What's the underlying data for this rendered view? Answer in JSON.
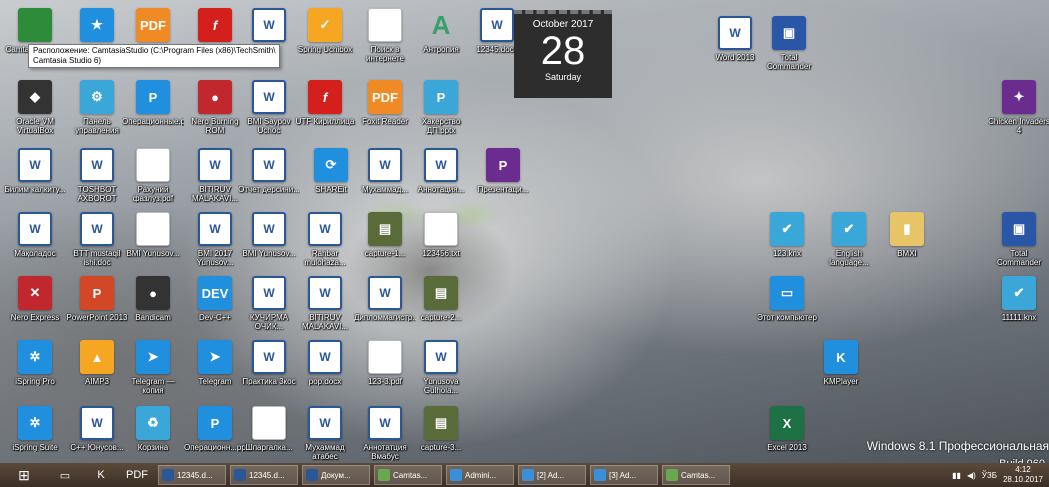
{
  "tooltip": {
    "line1": "Расположение: CamtasiaStudio (C:\\Program Files (x86)\\TechSmith\\",
    "line2": "Camtasia Studio 6)"
  },
  "calendar": {
    "month": "October 2017",
    "day": "28",
    "weekday": "Saturday"
  },
  "watermark": {
    "edition": "Windows 8.1 Профессиональная",
    "build": "Build 960"
  },
  "icons": [
    {
      "label": "Camtasia Studio",
      "glyph": "",
      "kind": "green"
    },
    {
      "label": "",
      "glyph": "★",
      "kind": "blue"
    },
    {
      "label": "",
      "glyph": "PDF",
      "kind": "pdf"
    },
    {
      "label": "",
      "glyph": "f",
      "kind": "flash"
    },
    {
      "label": "",
      "glyph": "W",
      "kind": "word"
    },
    {
      "label": "Spring Uchibox",
      "glyph": "✓",
      "kind": "orange"
    },
    {
      "label": "Поиск в интернете",
      "glyph": "",
      "kind": "doc"
    },
    {
      "label": "Антропия",
      "glyph": "A",
      "kind": "font"
    },
    {
      "label": "12345.docx",
      "glyph": "W",
      "kind": "word"
    },
    {
      "label": "Word 2013",
      "glyph": "W",
      "kind": "word"
    },
    {
      "label": "Total Commander",
      "glyph": "▣",
      "kind": "floppy"
    },
    {
      "label": "Oracle VM VirtualBox",
      "glyph": "◆",
      "kind": "dark"
    },
    {
      "label": "Панель управления",
      "glyph": "⚙",
      "kind": "cyan"
    },
    {
      "label": "Операционные.pptx",
      "glyph": "P",
      "kind": "blue"
    },
    {
      "label": "Nero Burning ROM",
      "glyph": "●",
      "kind": "red"
    },
    {
      "label": "BMI Saypov Uchoc",
      "glyph": "W",
      "kind": "word"
    },
    {
      "label": "UTF Кириллица",
      "glyph": "f",
      "kind": "flash"
    },
    {
      "label": "Foxit Reader",
      "glyph": "PDF",
      "kind": "pdf"
    },
    {
      "label": "Хакерство ДП.pptx",
      "glyph": "P",
      "kind": "cyan"
    },
    {
      "label": "Chicken Invaders 4",
      "glyph": "✦",
      "kind": "purple"
    },
    {
      "label": "Билим калкиту...",
      "glyph": "W",
      "kind": "word"
    },
    {
      "label": "TOSHBOT AXBOROT",
      "glyph": "W",
      "kind": "word"
    },
    {
      "label": "Рахуний фазлуз.pdf",
      "glyph": "",
      "kind": "doc"
    },
    {
      "label": "BITIRUV MALAKAVI...",
      "glyph": "W",
      "kind": "word"
    },
    {
      "label": "Отчет дерсини...",
      "glyph": "W",
      "kind": "word"
    },
    {
      "label": "SHAREit",
      "glyph": "⟳",
      "kind": "blue"
    },
    {
      "label": "Мухаммад...",
      "glyph": "W",
      "kind": "word"
    },
    {
      "label": "Аннотация...",
      "glyph": "W",
      "kind": "word"
    },
    {
      "label": "Презентаци...",
      "glyph": "P",
      "kind": "purple"
    },
    {
      "label": "Мақоладоc",
      "glyph": "W",
      "kind": "word"
    },
    {
      "label": "BTT mustaqil ishi.doc",
      "glyph": "W",
      "kind": "word"
    },
    {
      "label": "BMI Yunusov...",
      "glyph": "",
      "kind": "doc"
    },
    {
      "label": "BMI 2017 Yunusov...",
      "glyph": "W",
      "kind": "word"
    },
    {
      "label": "BMI Yunusov...",
      "glyph": "W",
      "kind": "word"
    },
    {
      "label": "Rahbar mulohaza...",
      "glyph": "W",
      "kind": "word"
    },
    {
      "label": "capture-1...",
      "glyph": "▤",
      "kind": "film"
    },
    {
      "label": "123456.txt",
      "glyph": "",
      "kind": "doc"
    },
    {
      "label": "123.knx",
      "glyph": "✔",
      "kind": "cyan"
    },
    {
      "label": "English language...",
      "glyph": "✔",
      "kind": "cyan"
    },
    {
      "label": "BMXI",
      "glyph": "▮",
      "kind": "folder"
    },
    {
      "label": "Total Commander",
      "glyph": "▣",
      "kind": "floppy"
    },
    {
      "label": "Nero Express",
      "glyph": "✕",
      "kind": "red"
    },
    {
      "label": "PowerPoint 2013",
      "glyph": "P",
      "kind": "ppt"
    },
    {
      "label": "Bandicam",
      "glyph": "●",
      "kind": "dark"
    },
    {
      "label": "Dev-C++",
      "glyph": "DEV",
      "kind": "blue"
    },
    {
      "label": "КУЧИРМА ОЧИК...",
      "glyph": "W",
      "kind": "word"
    },
    {
      "label": "BITIRUV MALAKAVI...",
      "glyph": "W",
      "kind": "word"
    },
    {
      "label": "Дипломмагистр...",
      "glyph": "W",
      "kind": "word"
    },
    {
      "label": "capture-2...",
      "glyph": "▤",
      "kind": "film"
    },
    {
      "label": "Этот компьютер",
      "glyph": "▭",
      "kind": "blue"
    },
    {
      "label": "11111.knx",
      "glyph": "✔",
      "kind": "cyan"
    },
    {
      "label": "iSpring Pro",
      "glyph": "✲",
      "kind": "blue"
    },
    {
      "label": "AIMP3",
      "glyph": "▲",
      "kind": "orange"
    },
    {
      "label": "Telegram — копия",
      "glyph": "➤",
      "kind": "blue"
    },
    {
      "label": "Telegram",
      "glyph": "➤",
      "kind": "blue"
    },
    {
      "label": "Практика 3коc",
      "glyph": "W",
      "kind": "word"
    },
    {
      "label": "pop.docx",
      "glyph": "W",
      "kind": "word"
    },
    {
      "label": "123-3.pdf",
      "glyph": "",
      "kind": "doc"
    },
    {
      "label": "Yunusova Gulhola...",
      "glyph": "W",
      "kind": "word"
    },
    {
      "label": "KMPlayer",
      "glyph": "K",
      "kind": "blue"
    },
    {
      "label": "iSpring Suite",
      "glyph": "✲",
      "kind": "blue"
    },
    {
      "label": "C++ Юнусов...",
      "glyph": "W",
      "kind": "word"
    },
    {
      "label": "Корзина",
      "glyph": "♻",
      "kind": "cyan"
    },
    {
      "label": "Операционн...pptx",
      "glyph": "P",
      "kind": "blue"
    },
    {
      "label": "Шпаргалка...",
      "glyph": "",
      "kind": "doc"
    },
    {
      "label": "Мухаммад aтaбеc",
      "glyph": "W",
      "kind": "word"
    },
    {
      "label": "Аннотатция Вмабус",
      "glyph": "W",
      "kind": "word"
    },
    {
      "label": "capture-3...",
      "glyph": "▤",
      "kind": "film"
    },
    {
      "label": "Excel 2013",
      "glyph": "X",
      "kind": "excel"
    }
  ],
  "taskbar": {
    "start_glyph": "⊞",
    "pins": [
      {
        "name": "explorer",
        "glyph": "▭"
      },
      {
        "name": "kmplayer",
        "glyph": "K"
      },
      {
        "name": "foxit",
        "glyph": "PDF"
      }
    ],
    "buttons": [
      {
        "label": "12345.d...",
        "color": "#2b5797"
      },
      {
        "label": "12345.d...",
        "color": "#2b5797"
      },
      {
        "label": "Докум...",
        "color": "#2b5797"
      },
      {
        "label": "Camtas...",
        "color": "#6aa84f"
      },
      {
        "label": "Admini...",
        "color": "#3a8fd8"
      },
      {
        "label": "[2] Ad...",
        "color": "#3a8fd8"
      },
      {
        "label": "[3] Ad...",
        "color": "#3a8fd8"
      },
      {
        "label": "Camtas...",
        "color": "#6aa84f"
      }
    ],
    "tray": {
      "lang": "ЎЗБ",
      "time": "4:12",
      "date": "28.10.2017"
    }
  }
}
